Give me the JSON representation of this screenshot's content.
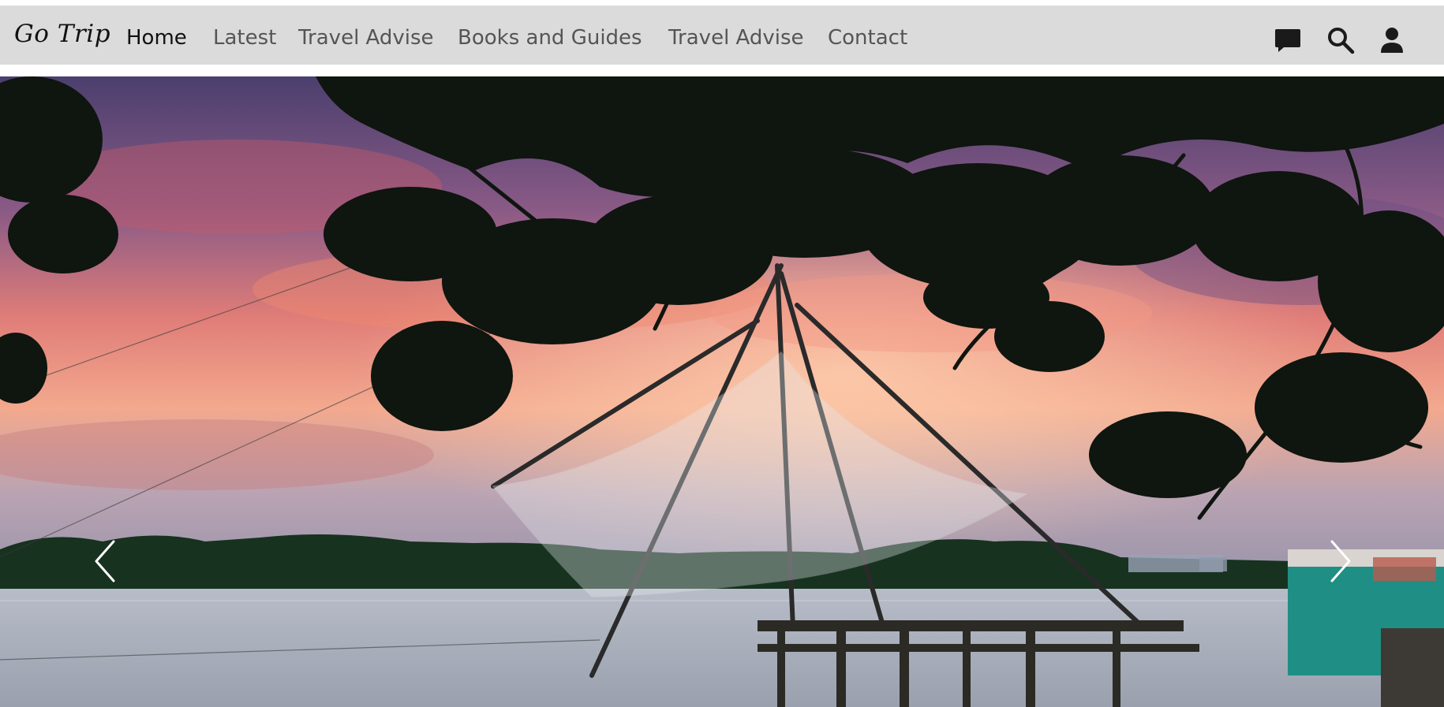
{
  "brand": {
    "name": "Go Trip"
  },
  "nav": {
    "items": [
      {
        "label": "Home",
        "active": true
      },
      {
        "label": "Latest",
        "active": false
      },
      {
        "label": "Travel Advise",
        "active": false
      },
      {
        "label": "Books and Guides",
        "active": false
      },
      {
        "label": "Travel Advise",
        "active": false
      },
      {
        "label": "Contact",
        "active": false
      }
    ]
  },
  "header_icons": [
    "chat-icon",
    "search-icon",
    "user-icon"
  ],
  "hero": {
    "image": "sunset over backwater with Chinese fishing net and tree silhouettes",
    "controls": [
      "chevron-left-icon",
      "chevron-right-icon"
    ]
  },
  "colors": {
    "navbar_bg": "#dcdbdc",
    "nav_active": "#111111",
    "nav_inactive": "#555555",
    "icon": "#1a1a1a"
  }
}
